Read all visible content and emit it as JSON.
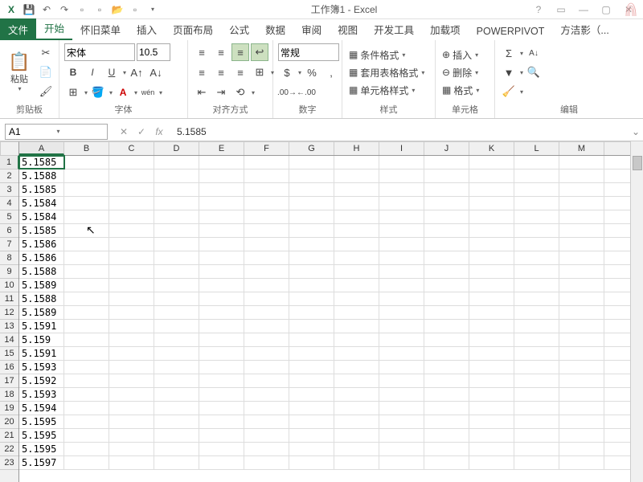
{
  "title": "工作簿1 - Excel",
  "qat": {
    "save": "💾",
    "undo": "↶",
    "redo": "↷"
  },
  "tabs": {
    "file": "文件",
    "home": "开始",
    "legacy": "怀旧菜单",
    "insert": "插入",
    "layout": "页面布局",
    "formula": "公式",
    "data": "数据",
    "review": "审阅",
    "view": "视图",
    "dev": "开发工具",
    "addins": "加载项",
    "powerpivot": "POWERPIVOT",
    "user": "方洁影（..."
  },
  "ribbon": {
    "clipboard": {
      "label": "剪贴板",
      "paste": "粘贴"
    },
    "font": {
      "label": "字体",
      "name": "宋体",
      "size": "10.5"
    },
    "align": {
      "label": "对齐方式"
    },
    "number": {
      "label": "数字",
      "format": "常规"
    },
    "styles": {
      "label": "样式",
      "cond": "条件格式",
      "table": "套用表格格式",
      "cell": "单元格样式"
    },
    "cells": {
      "label": "单元格",
      "insert": "插入",
      "delete": "删除",
      "format": "格式"
    },
    "edit": {
      "label": "编辑"
    }
  },
  "formula": {
    "cell": "A1",
    "value": "5.1585"
  },
  "cols": [
    "A",
    "B",
    "C",
    "D",
    "E",
    "F",
    "G",
    "H",
    "I",
    "J",
    "K",
    "L",
    "M"
  ],
  "rows": [
    "1",
    "2",
    "3",
    "4",
    "5",
    "6",
    "7",
    "8",
    "9",
    "10",
    "11",
    "12",
    "13",
    "14",
    "15",
    "16",
    "17",
    "18",
    "19",
    "20",
    "21",
    "22",
    "23"
  ],
  "data": {
    "A": [
      "5.1585",
      "5.1588",
      "5.1585",
      "5.1584",
      "5.1584",
      "5.1585",
      "5.1586",
      "5.1586",
      "5.1588",
      "5.1589",
      "5.1588",
      "5.1589",
      "5.1591",
      "5.159",
      "5.1591",
      "5.1593",
      "5.1592",
      "5.1593",
      "5.1594",
      "5.1595",
      "5.1595",
      "5.1595",
      "5.1597"
    ]
  }
}
